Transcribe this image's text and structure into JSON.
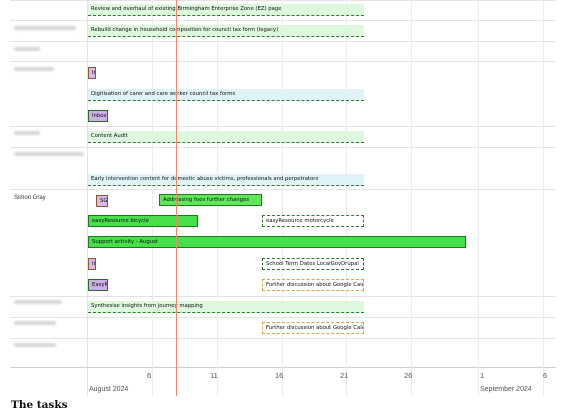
{
  "caption": "The tasks",
  "month_labels": [
    "August 2024",
    "September 2024"
  ],
  "tick_labels": [
    "6",
    "11",
    "16",
    "21",
    "26",
    "1",
    "6"
  ],
  "today_marker_date": "2024-08-08",
  "people": [
    {
      "name": "",
      "blurred": true
    },
    {
      "name": "",
      "blurred": true
    },
    {
      "name": "",
      "blurred": true
    },
    {
      "name": "",
      "blurred": true
    },
    {
      "name": "",
      "blurred": true
    },
    {
      "name": "",
      "blurred": true
    },
    {
      "name": "Simon Gray",
      "blurred": false
    },
    {
      "name": "",
      "blurred": true
    },
    {
      "name": "",
      "blurred": true
    },
    {
      "name": "",
      "blurred": true
    }
  ],
  "tasks": [
    {
      "label": "Review and overhaul of existing Birmingham Enterprise Zone (EZ) page",
      "start": "2024-08-01",
      "end": "2024-08-22",
      "style": "lightgreen"
    },
    {
      "label": "Rebuild change in household composition for council tax form (legacy)",
      "start": "2024-08-01",
      "end": "2024-08-22",
      "style": "lightgreen"
    },
    {
      "label": "In",
      "start": "2024-08-01",
      "end": "2024-08-01",
      "style": "purple"
    },
    {
      "label": "Digitisation of carer and care worker council tax forms",
      "start": "2024-08-01",
      "end": "2024-08-22",
      "style": "dashed-blue"
    },
    {
      "label": "Inbox",
      "start": "2024-08-01",
      "end": "2024-08-02",
      "style": "purple-dark"
    },
    {
      "label": "Content Audit",
      "start": "2024-08-01",
      "end": "2024-08-22",
      "style": "lightgreen"
    },
    {
      "label": "Early intervention content for domestic abuse victims, professionals and perpetrators",
      "start": "2024-08-01",
      "end": "2024-08-22",
      "style": "dashed-blue"
    },
    {
      "label": "SG",
      "start": "2024-08-02",
      "end": "2024-08-02",
      "style": "purple"
    },
    {
      "label": "Addressing fees further changes",
      "start": "2024-08-06",
      "end": "2024-08-14",
      "style": "solid-green2"
    },
    {
      "label": "easyResource bicycle",
      "start": "2024-08-01",
      "end": "2024-08-09",
      "style": "solid-green"
    },
    {
      "label": "easyResource motorcycle",
      "start": "2024-08-15",
      "end": "2024-08-22",
      "style": "dashed-green-boxed"
    },
    {
      "label": "Support activity - August",
      "start": "2024-08-01",
      "end": "2024-08-30",
      "style": "solid-green"
    },
    {
      "label": "In",
      "start": "2024-08-01",
      "end": "2024-08-01",
      "style": "purple"
    },
    {
      "label": "School Term Dates LocalGovDrupal",
      "start": "2024-08-15",
      "end": "2024-08-22",
      "style": "dashed-green-boxed"
    },
    {
      "label": "EasyR",
      "start": "2024-08-01",
      "end": "2024-08-02",
      "style": "purple-dark"
    },
    {
      "label": "Further discussion about Google Calendar",
      "start": "2024-08-15",
      "end": "2024-08-22",
      "style": "dashed-orange"
    },
    {
      "label": "Synthesise insights from journey mapping",
      "start": "2024-08-01",
      "end": "2024-08-22",
      "style": "lightgreen"
    },
    {
      "label": "Further discussion about Google Calendar",
      "start": "2024-08-15",
      "end": "2024-08-22",
      "style": "dashed-orange"
    }
  ]
}
